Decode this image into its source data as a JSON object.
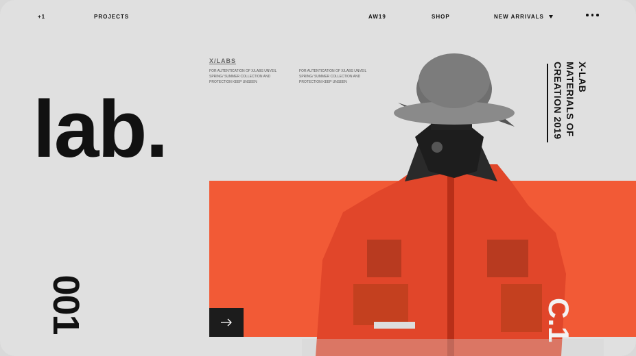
{
  "nav": {
    "logo": "+1",
    "projects": "PROJECTS",
    "aw19": "AW19",
    "shop": "SHOP",
    "new_arrivals": "NEW ARRIVALS"
  },
  "hero": {
    "word": "lab.",
    "number": "001"
  },
  "info": {
    "heading": "X/LABS",
    "col1": "FOR AUTENTICATION OF X/LABS UNVEIL SPRING/ SUMMER COLLECTION AND PROTECTION KEEP UNSEEN",
    "col2": "FOR AUTENTICATION OF X/LABS UNVEIL SPRING/ SUMMER COLLECTION AND PROTECTION KEEP UNSEEN"
  },
  "side_title": {
    "line1": "X-LAB",
    "line2": "MATERIALS OF",
    "line3": "CREATION 2019"
  },
  "photo": {
    "jacket_mark": "C.1"
  },
  "colors": {
    "accent": "#f25a36",
    "dark": "#1c1c1c",
    "background": "#e0e0e0"
  },
  "icons": {
    "arrow": "arrow-right-icon",
    "menu": "more-dots-icon",
    "dropdown": "caret-down-icon"
  }
}
